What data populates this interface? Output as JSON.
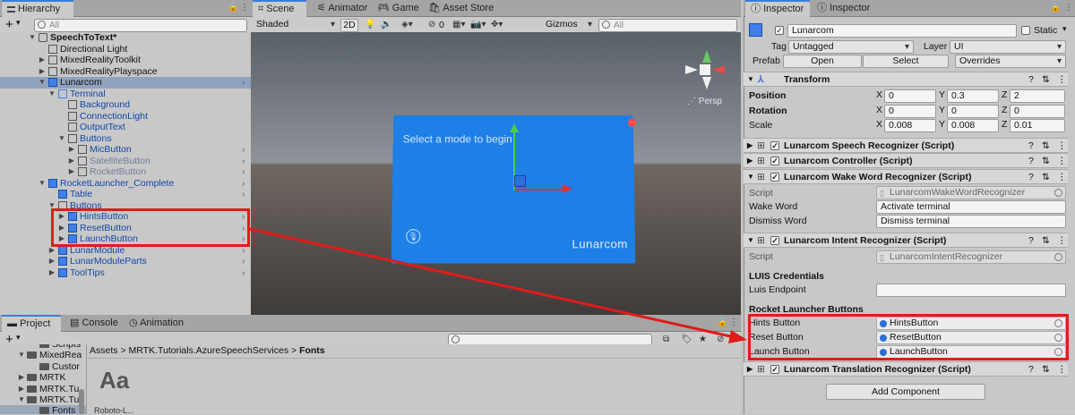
{
  "hierarchy": {
    "tab": "Hierarchy",
    "add": "+",
    "search_placeholder": "All",
    "rows": [
      {
        "label": "SpeechToText*",
        "color": "black",
        "bold": true,
        "arrow": "▼",
        "icon": "unity"
      },
      {
        "label": "Directional Light",
        "color": "black",
        "arrow": "",
        "icon": "grey"
      },
      {
        "label": "MixedRealityToolkit",
        "color": "black",
        "arrow": "▶",
        "icon": "grey"
      },
      {
        "label": "MixedRealityPlayspace",
        "color": "black",
        "arrow": "▶",
        "icon": "grey"
      },
      {
        "label": "Lunarcom",
        "color": "black",
        "arrow": "▼",
        "icon": "blue",
        "selected": true
      },
      {
        "label": "Terminal",
        "color": "blue",
        "arrow": "▼",
        "icon": "lightblue"
      },
      {
        "label": "Background",
        "color": "blue",
        "arrow": "",
        "icon": "grey"
      },
      {
        "label": "ConnectionLight",
        "color": "blue",
        "arrow": "",
        "icon": "grey"
      },
      {
        "label": "OutputText",
        "color": "blue",
        "arrow": "",
        "icon": "grey"
      },
      {
        "label": "Buttons",
        "color": "blue",
        "arrow": "▼",
        "icon": "grey"
      },
      {
        "label": "MicButton",
        "color": "blue",
        "arrow": "▶",
        "icon": "grey"
      },
      {
        "label": "SatelliteButton",
        "color": "grey",
        "arrow": "▶",
        "icon": "grey"
      },
      {
        "label": "RocketButton",
        "color": "grey",
        "arrow": "▶",
        "icon": "grey"
      },
      {
        "label": "RocketLauncher_Complete",
        "color": "blue",
        "arrow": "▼",
        "icon": "blue"
      },
      {
        "label": "Table",
        "color": "blue",
        "arrow": "",
        "icon": "blue"
      },
      {
        "label": "Buttons",
        "color": "blue",
        "arrow": "▼",
        "icon": "grey"
      },
      {
        "label": "HintsButton",
        "color": "blue",
        "arrow": "▶",
        "icon": "blue"
      },
      {
        "label": "ResetButton",
        "color": "blue",
        "arrow": "▶",
        "icon": "blue"
      },
      {
        "label": "LaunchButton",
        "color": "blue",
        "arrow": "▶",
        "icon": "blue"
      },
      {
        "label": "LunarModule",
        "color": "blue",
        "arrow": "▶",
        "icon": "blue"
      },
      {
        "label": "LunarModuleParts",
        "color": "blue",
        "arrow": "▶",
        "icon": "blue"
      },
      {
        "label": "ToolTips",
        "color": "blue",
        "arrow": "▶",
        "icon": "blue"
      }
    ]
  },
  "scene": {
    "tabs": [
      "Scene",
      "Animator",
      "Game",
      "Asset Store"
    ],
    "shading": "Shaded",
    "mode_2d": "2D",
    "fx_count": "0",
    "gizmos": "Gizmos",
    "search_placeholder": "All",
    "panel_text": "Select a mode to begin.",
    "panel_brand": "Lunarcom",
    "persp_label": "Persp"
  },
  "project": {
    "tabs": [
      "Project",
      "Console",
      "Animation"
    ],
    "breadcrumb": [
      "Assets",
      "MRTK.Tutorials.AzureSpeechServices",
      "Fonts"
    ],
    "tree": [
      {
        "label": "Scripts",
        "indent": 1
      },
      {
        "label": "MixedRea",
        "indent": 0,
        "arrow": "▼"
      },
      {
        "label": "Custor",
        "indent": 1
      },
      {
        "label": "MRTK",
        "indent": 0,
        "arrow": "▶"
      },
      {
        "label": "MRTK.Tu",
        "indent": 0,
        "arrow": "▶"
      },
      {
        "label": "MRTK.Tu",
        "indent": 0,
        "arrow": "▼"
      },
      {
        "label": "Fonts",
        "indent": 1,
        "selected": true
      }
    ],
    "asset_glyph": "Aa",
    "asset_name": "Roboto-L..."
  },
  "inspector": {
    "tabs": [
      "Inspector",
      "Inspector"
    ],
    "object_name": "Lunarcom",
    "static_label": "Static",
    "tag_label": "Tag",
    "tag_value": "Untagged",
    "layer_label": "Layer",
    "layer_value": "UI",
    "prefab_label": "Prefab",
    "prefab_open": "Open",
    "prefab_select": "Select",
    "prefab_overrides": "Overrides",
    "transform": {
      "title": "Transform",
      "position": {
        "label": "Position",
        "x": "0",
        "y": "0.3",
        "z": "2"
      },
      "rotation": {
        "label": "Rotation",
        "x": "0",
        "y": "0",
        "z": "0"
      },
      "scale": {
        "label": "Scale",
        "x": "0.008",
        "y": "0.008",
        "z": "0.01"
      }
    },
    "components": {
      "speech": "Lunarcom Speech Recognizer (Script)",
      "controller": "Lunarcom Controller (Script)",
      "wake": "Lunarcom Wake Word Recognizer (Script)",
      "intent": "Lunarcom Intent Recognizer (Script)",
      "translation": "Lunarcom Translation Recognizer (Script)"
    },
    "wake_fields": {
      "script_label": "Script",
      "script_value": "LunarcomWakeWordRecognizer",
      "wake_label": "Wake Word",
      "wake_value": "Activate terminal",
      "dismiss_label": "Dismiss Word",
      "dismiss_value": "Dismiss terminal"
    },
    "intent_fields": {
      "script_label": "Script",
      "script_value": "LunarcomIntentRecognizer",
      "luis_header": "LUIS Credentials",
      "endpoint_label": "Luis Endpoint",
      "endpoint_value": "",
      "rocket_header": "Rocket Launcher Buttons",
      "hints_label": "Hints Button",
      "hints_value": "HintsButton",
      "reset_label": "Reset Button",
      "reset_value": "ResetButton",
      "launch_label": "Launch Button",
      "launch_value": "LaunchButton"
    },
    "add_component": "Add Component"
  },
  "colors": {
    "accent_red": "#e01b1b",
    "unity_blue": "#2d6fd8",
    "panel_blue": "#1e7fe6"
  }
}
